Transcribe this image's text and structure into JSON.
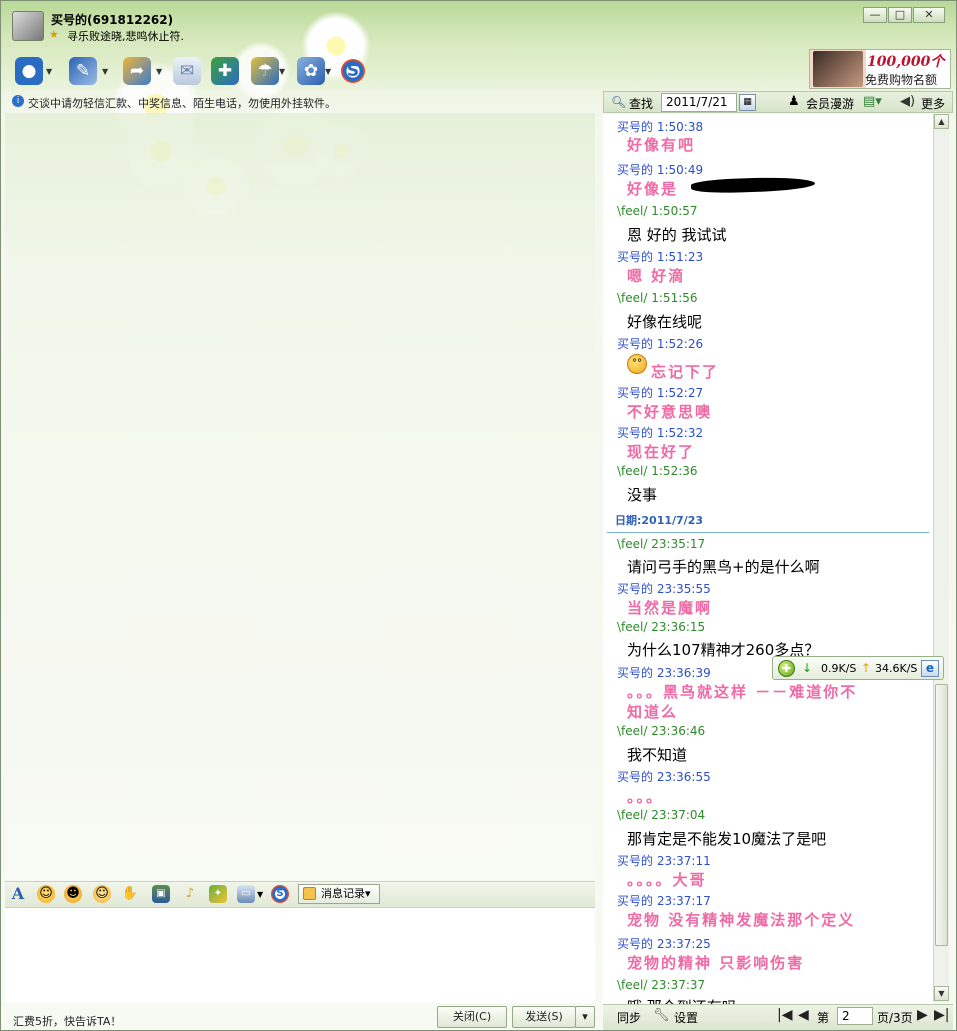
{
  "window": {
    "nickname": "买号的(691812262)",
    "signature": "寻乐败途晓,悲鸣休止符.",
    "controls": {
      "minimize": "—",
      "maximize": "□",
      "close": "✕"
    }
  },
  "toolbar": {
    "icons": [
      "video-call-icon",
      "voice-call-icon",
      "send-file-icon",
      "send-email-icon",
      "add-app-icon",
      "remote-assist-icon",
      "more-apps-icon",
      "sogou-icon"
    ]
  },
  "ad": {
    "headline": "100,000个",
    "subline": "免费购物名额"
  },
  "notice": "交谈中请勿轻信汇款、中奖信息、陌生电话，勿使用外挂软件。",
  "input_toolbar": {
    "message_record": "消息记录▾"
  },
  "footer": {
    "promo": "汇费5折，快告诉TA！",
    "close_button": "关闭(C)",
    "send_button": "发送(S)",
    "send_dropdown": "▾"
  },
  "history_toolbar": {
    "search_label": "查找",
    "date_value": "2011/7/21",
    "member_label": "会员漫游",
    "more_label": "更多"
  },
  "history": {
    "date_header": "日期:2011/7/23",
    "messages": [
      {
        "sender": "买号的",
        "time": "1:50:38",
        "text": "好像有吧"
      },
      {
        "sender": "买号的",
        "time": "1:50:49",
        "text": "好像是"
      },
      {
        "sender": "\\feel/",
        "time": "1:50:57",
        "text": "恩  好的  我试试"
      },
      {
        "sender": "买号的",
        "time": "1:51:23",
        "text": "嗯  好滴"
      },
      {
        "sender": "\\feel/",
        "time": "1:51:56",
        "text": "好像在线呢"
      },
      {
        "sender": "买号的",
        "time": "1:52:26",
        "text": "忘记下了"
      },
      {
        "sender": "买号的",
        "time": "1:52:27",
        "text": "不好意思噢"
      },
      {
        "sender": "买号的",
        "time": "1:52:32",
        "text": "现在好了"
      },
      {
        "sender": "\\feel/",
        "time": "1:52:36",
        "text": "没事"
      },
      {
        "sender": "\\feel/",
        "time": "23:35:17",
        "text": "请问弓手的黑鸟+的是什么啊"
      },
      {
        "sender": "买号的",
        "time": "23:35:55",
        "text": "当然是魔啊"
      },
      {
        "sender": "\\feel/",
        "time": "23:36:15",
        "text": "为什么107精神才260多点？"
      },
      {
        "sender": "买号的",
        "time": "23:36:39",
        "text": "。。。黑鸟就这样 －－难道你不"
      },
      {
        "sender": "",
        "time": "",
        "text": "知道么"
      },
      {
        "sender": "\\feel/",
        "time": "23:36:46",
        "text": "我不知道"
      },
      {
        "sender": "买号的",
        "time": "23:36:55",
        "text": "。。。"
      },
      {
        "sender": "\\feel/",
        "time": "23:37:04",
        "text": "那肯定是不能发10魔法了是吧"
      },
      {
        "sender": "买号的",
        "time": "23:37:11",
        "text": "。。。。大哥"
      },
      {
        "sender": "买号的",
        "time": "23:37:17",
        "text": "宠物 没有精神发魔法那个定义"
      },
      {
        "sender": "买号的",
        "time": "23:37:25",
        "text": "宠物的精神 只影响伤害"
      },
      {
        "sender": "\\feel/",
        "time": "23:37:37",
        "text": "哦  那个到还有吗"
      }
    ]
  },
  "net_monitor": {
    "download": "0.9K/S",
    "upload": "34.6K/S"
  },
  "history_footer": {
    "sync": "同步",
    "settings": "设置",
    "page_label": "第",
    "page_value": "2",
    "page_total": "页/3页"
  },
  "colors": {
    "seller": "#2c4ed0",
    "buyer": "#2d8c2a",
    "seller_text": "#f06aa6"
  }
}
